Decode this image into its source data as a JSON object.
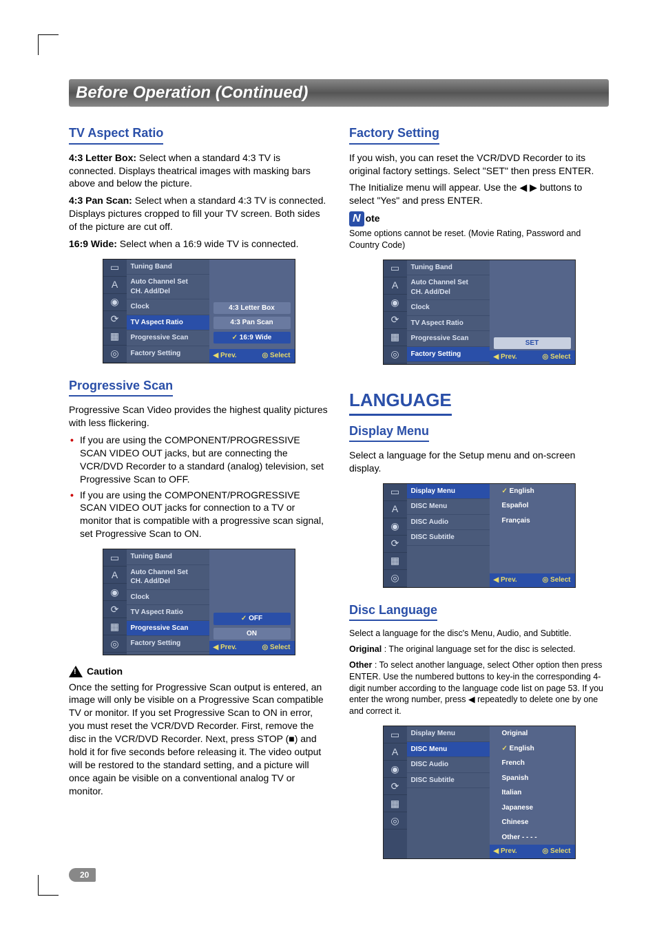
{
  "banner": "Before Operation (Continued)",
  "page_number": "20",
  "left": {
    "sec1": {
      "title": "TV Aspect Ratio",
      "p1a": "4:3 Letter Box:",
      "p1b": " Select when a standard 4:3 TV is connected. Displays theatrical images with masking bars above and below the picture.",
      "p2a": "4:3 Pan Scan:",
      "p2b": " Select when a standard 4:3 TV is connected. Displays pictures cropped to fill your TV screen. Both sides of the picture are cut off.",
      "p3a": "16:9 Wide:",
      "p3b": " Select when a 16:9 wide TV is connected.",
      "menu": {
        "items": [
          "Tuning Band",
          "Auto Channel Set\nCH. Add/Del",
          "Clock",
          "TV Aspect Ratio",
          "Progressive Scan",
          "Factory Setting"
        ],
        "sel_index": 3,
        "opts": [
          "4:3 Letter Box",
          "4:3 Pan Scan",
          "16:9 Wide"
        ],
        "opt_sel": 2,
        "footer_l": "Prev.",
        "footer_r": "Select"
      }
    },
    "sec2": {
      "title": "Progressive Scan",
      "intro": "Progressive Scan Video provides the highest quality pictures with less flickering.",
      "b1": "If you are using the COMPONENT/PROGRESSIVE SCAN VIDEO OUT jacks, but are connecting the VCR/DVD Recorder to a standard (analog) television, set Progressive Scan to OFF.",
      "b2": "If you are using the COMPONENT/PROGRESSIVE SCAN VIDEO OUT jacks for connection to a TV or monitor that is compatible with a progressive scan signal, set Progressive Scan to ON.",
      "menu": {
        "items": [
          "Tuning Band",
          "Auto Channel Set\nCH. Add/Del",
          "Clock",
          "TV Aspect Ratio",
          "Progressive Scan",
          "Factory Setting"
        ],
        "sel_index": 4,
        "opts": [
          "OFF",
          "ON"
        ],
        "opt_sel": 0,
        "footer_l": "Prev.",
        "footer_r": "Select"
      },
      "caution_label": "Caution",
      "caution_text": "Once the setting for Progressive Scan output is entered, an image will only be visible on a Progressive Scan compatible TV or monitor. If you set Progressive Scan to ON in error, you must reset the VCR/DVD Recorder. First, remove the disc in the VCR/DVD Recorder. Next, press STOP (■) and hold it for five seconds before releasing it. The video output will be restored to the standard setting, and a picture will once again be visible on a conventional analog TV or monitor."
    }
  },
  "right": {
    "sec1": {
      "title": "Factory Setting",
      "p1": "If you wish, you can reset the VCR/DVD Recorder to its original factory settings. Select \"SET\" then press ENTER.",
      "p2": "The Initialize menu will appear. Use the ◀ ▶ buttons to select \"Yes\" and press ENTER.",
      "note_n": "N",
      "note_label": "ote",
      "note_text": "Some options cannot be reset. (Movie Rating, Password and Country Code)",
      "menu": {
        "items": [
          "Tuning Band",
          "Auto Channel Set\nCH. Add/Del",
          "Clock",
          "TV Aspect Ratio",
          "Progressive Scan",
          "Factory Setting"
        ],
        "sel_index": 5,
        "opts": [
          "SET"
        ],
        "footer_l": "Prev.",
        "footer_r": "Select"
      }
    },
    "lang_title": "LANGUAGE",
    "sec2": {
      "title": "Display Menu",
      "p1": "Select a language for the Setup menu and on-screen display.",
      "menu": {
        "items": [
          "Display Menu",
          "DISC Menu",
          "DISC Audio",
          "DISC Subtitle"
        ],
        "sel_index": 0,
        "opts": [
          "English",
          "Español",
          "Français"
        ],
        "opt_sel": 0,
        "footer_l": "Prev.",
        "footer_r": "Select"
      }
    },
    "sec3": {
      "title": "Disc Language",
      "p1": "Select a language for the disc's Menu, Audio, and Subtitle.",
      "p2a": "Original",
      "p2b": " : The original language set for the disc is selected.",
      "p3a": "Other",
      "p3b": " : To select another language, select Other option then press ENTER. Use the numbered buttons to key-in the corresponding 4-digit number according to the language code list on page 53. If you enter the wrong number, press ◀ repeatedly to delete one by one and correct it.",
      "menu": {
        "items": [
          "Display Menu",
          "DISC Menu",
          "DISC Audio",
          "DISC Subtitle"
        ],
        "sel_index": 1,
        "opts": [
          "Original",
          "English",
          "French",
          "Spanish",
          "Italian",
          "Japanese",
          "Chinese",
          "Other   - - - -"
        ],
        "opt_sel": 1,
        "footer_l": "Prev.",
        "footer_r": "Select"
      }
    }
  },
  "icons6": [
    "▭",
    "A",
    "◉",
    "⟳",
    "▦",
    "◎"
  ],
  "icons6b": [
    "▭",
    "A",
    "◉",
    "⟳",
    "▦",
    "◎"
  ]
}
